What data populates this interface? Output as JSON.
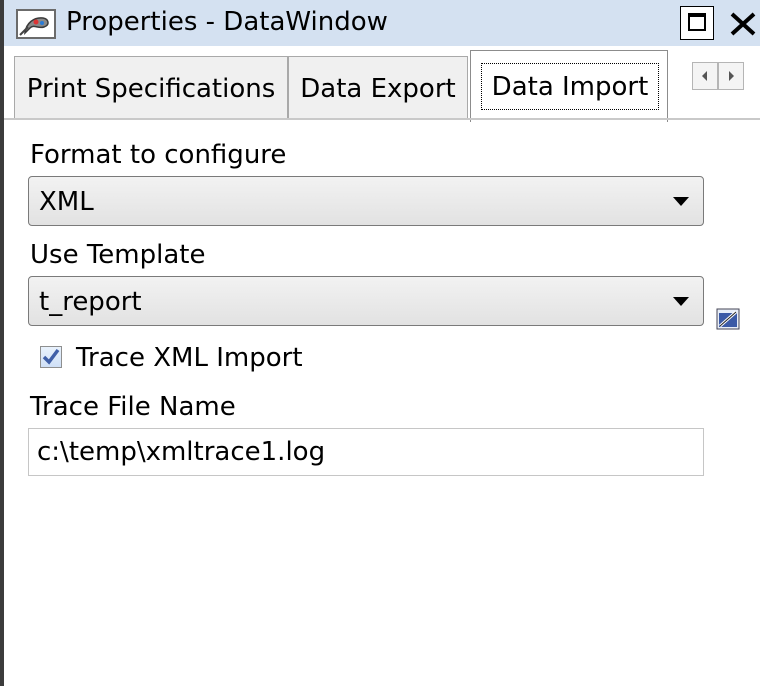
{
  "window": {
    "title": "Properties - DataWindow",
    "icon": "properties-icon"
  },
  "tabs": [
    {
      "label": "Print Specifications",
      "selected": false
    },
    {
      "label": "Data Export",
      "selected": false
    },
    {
      "label": "Data Import",
      "selected": true
    }
  ],
  "form": {
    "format_label": "Format to configure",
    "format_value": "XML",
    "template_label": "Use Template",
    "template_value": "t_report",
    "trace_checkbox_label": "Trace XML Import",
    "trace_checked": true,
    "trace_file_label": "Trace File Name",
    "trace_file_value": "c:\\temp\\xmltrace1.log"
  },
  "colors": {
    "titlebar_bg": "#d4e1f1",
    "tab_bg": "#f0f0f0",
    "checkmark": "#3f5fa8"
  }
}
